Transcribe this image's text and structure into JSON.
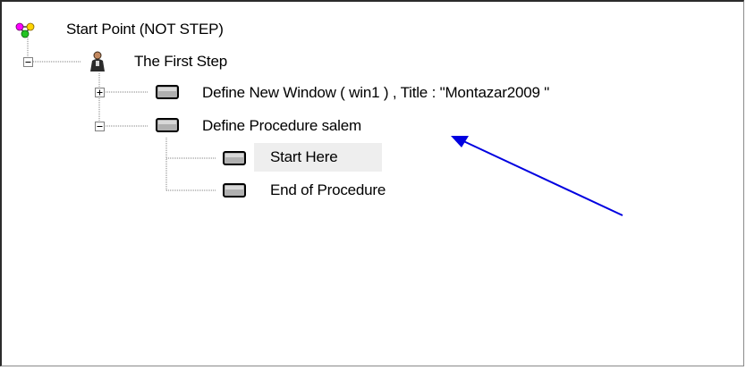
{
  "tree": {
    "root": {
      "label": "Start Point (NOT STEP)",
      "icon": "colored-nodes-icon"
    },
    "step": {
      "label": "The First Step",
      "icon": "person-icon",
      "expander": "collapse"
    },
    "items": [
      {
        "label": "Define New Window  ( win1 ) , Title : \"Montazar2009  \"",
        "icon": "grey-box-icon",
        "expander": "expand"
      },
      {
        "label": "Define Procedure salem",
        "icon": "grey-box-icon",
        "expander": "collapse"
      }
    ],
    "children": [
      {
        "label": "Start Here",
        "icon": "grey-box-icon",
        "selected": true
      },
      {
        "label": "End of Procedure",
        "icon": "grey-box-icon",
        "selected": false
      }
    ]
  },
  "annotation": {
    "arrow_color": "#0000e0"
  }
}
